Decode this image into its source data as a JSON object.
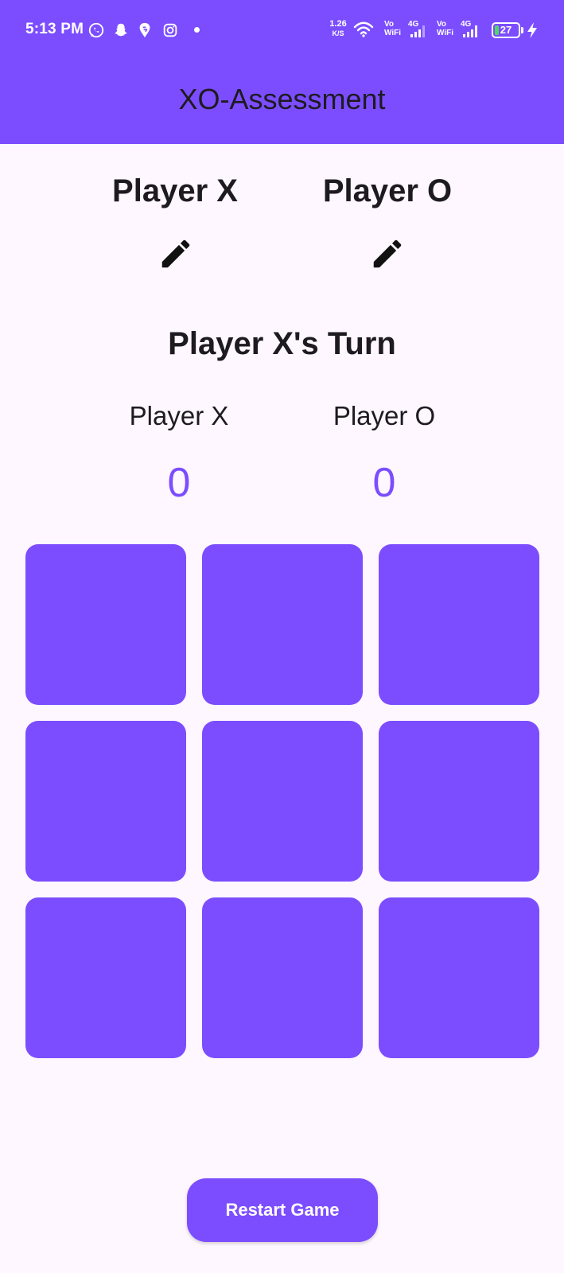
{
  "status_bar": {
    "time": "5:13 PM",
    "notification_icons": [
      "whatsapp-icon",
      "snapchat-icon",
      "swiggy-icon",
      "instagram-icon"
    ],
    "net_speed": "1.26",
    "net_speed_unit": "K/S",
    "vowifi_top": "Vo",
    "vowifi_bottom": "WiFi",
    "network_type": "4G",
    "battery_level": "27"
  },
  "app_bar": {
    "title": "XO-Assessment"
  },
  "players": {
    "x_name": "Player X",
    "o_name": "Player O"
  },
  "turn": {
    "label": "Player X's Turn"
  },
  "scoreboard": {
    "x_label": "Player X",
    "o_label": "Player O",
    "x_score": "0",
    "o_score": "0"
  },
  "board": {
    "cells": [
      "",
      "",
      "",
      "",
      "",
      "",
      "",
      "",
      ""
    ]
  },
  "actions": {
    "restart_label": "Restart Game"
  },
  "colors": {
    "primary": "#7C4DFF",
    "background": "#FEF7FF",
    "text": "#1D1B20",
    "on_primary": "#FFFFFF",
    "battery_fill": "#4CD964"
  }
}
